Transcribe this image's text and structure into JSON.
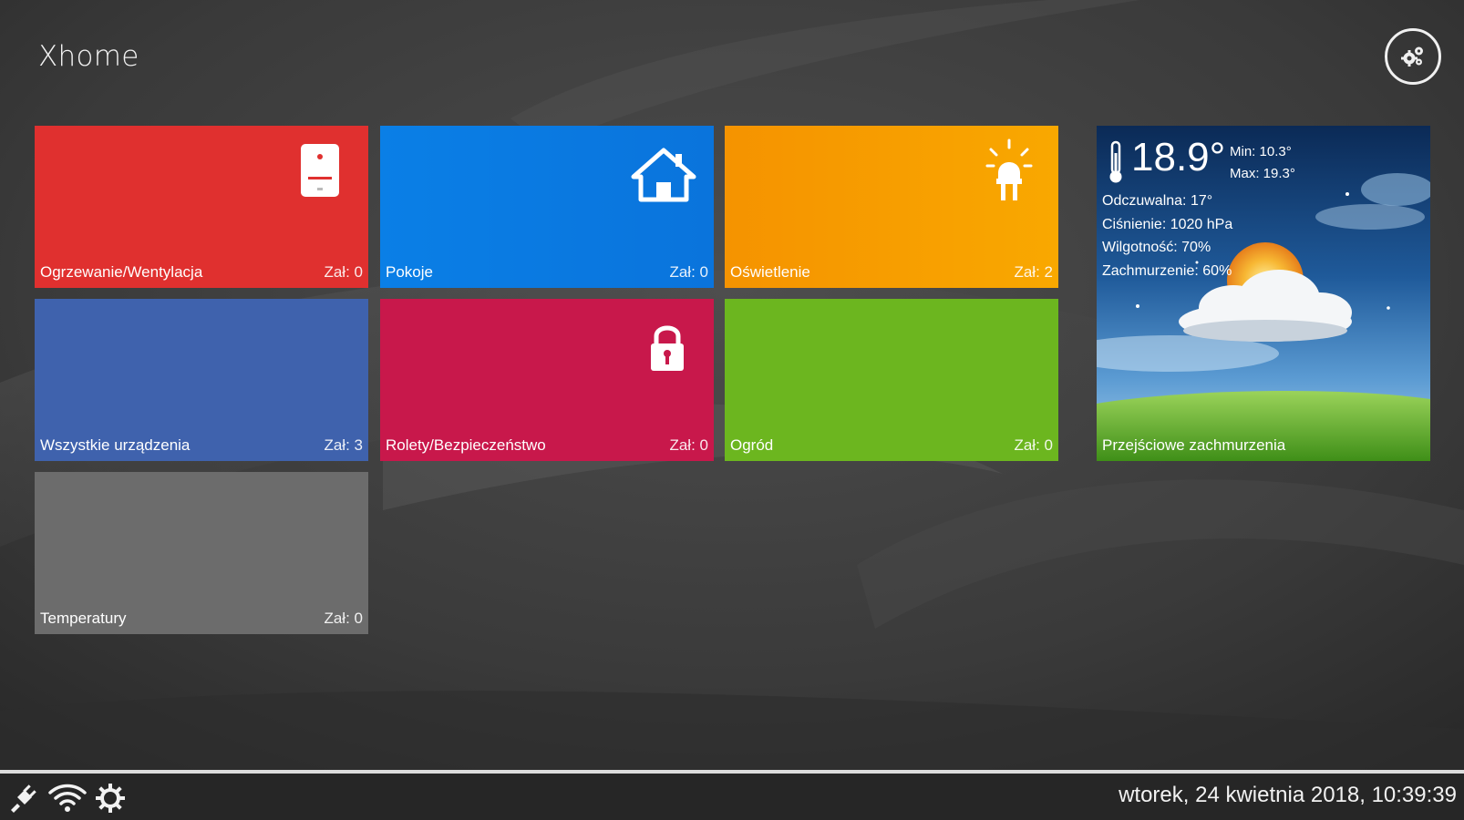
{
  "app": {
    "title": "Xhome"
  },
  "tiles": [
    {
      "label": "Ogrzewanie/Wentylacja",
      "count": "Zał: 0",
      "icon": "boiler-icon",
      "color": "#e0302f"
    },
    {
      "label": "Pokoje",
      "count": "Zał: 0",
      "icon": "house-icon",
      "color": "#0a7fe6"
    },
    {
      "label": "Oświetlenie",
      "count": "Zał: 2",
      "icon": "light-bulb-icon",
      "color": "#f59300"
    },
    {
      "label": "Wszystkie urządzenia",
      "count": "Zał: 3",
      "icon": "",
      "color": "#3f62ad"
    },
    {
      "label": "Rolety/Bezpieczeństwo",
      "count": "Zał: 0",
      "icon": "padlock-icon",
      "color": "#c8184b"
    },
    {
      "label": "Ogród",
      "count": "Zał: 0",
      "icon": "",
      "color": "#6cb61f"
    },
    {
      "label": "Temperatury",
      "count": "Zał: 0",
      "icon": "",
      "color": "#6c6c6c"
    }
  ],
  "weather": {
    "temperature": "18.9°",
    "min": "Min: 10.3°",
    "max": "Max: 19.3°",
    "feels_like": "Odczuwalna: 17°",
    "pressure": "Ciśnienie: 1020 hPa",
    "humidity": "Wilgotność: 70%",
    "cloudiness": "Zachmurzenie: 60%",
    "condition": "Przejściowe zachmurzenia",
    "icon": "thermometer-icon"
  },
  "taskbar": {
    "icons": [
      "plug-icon",
      "wifi-icon",
      "gear-icon"
    ],
    "datetime": "wtorek, 24 kwietnia 2018, 10:39:39"
  }
}
